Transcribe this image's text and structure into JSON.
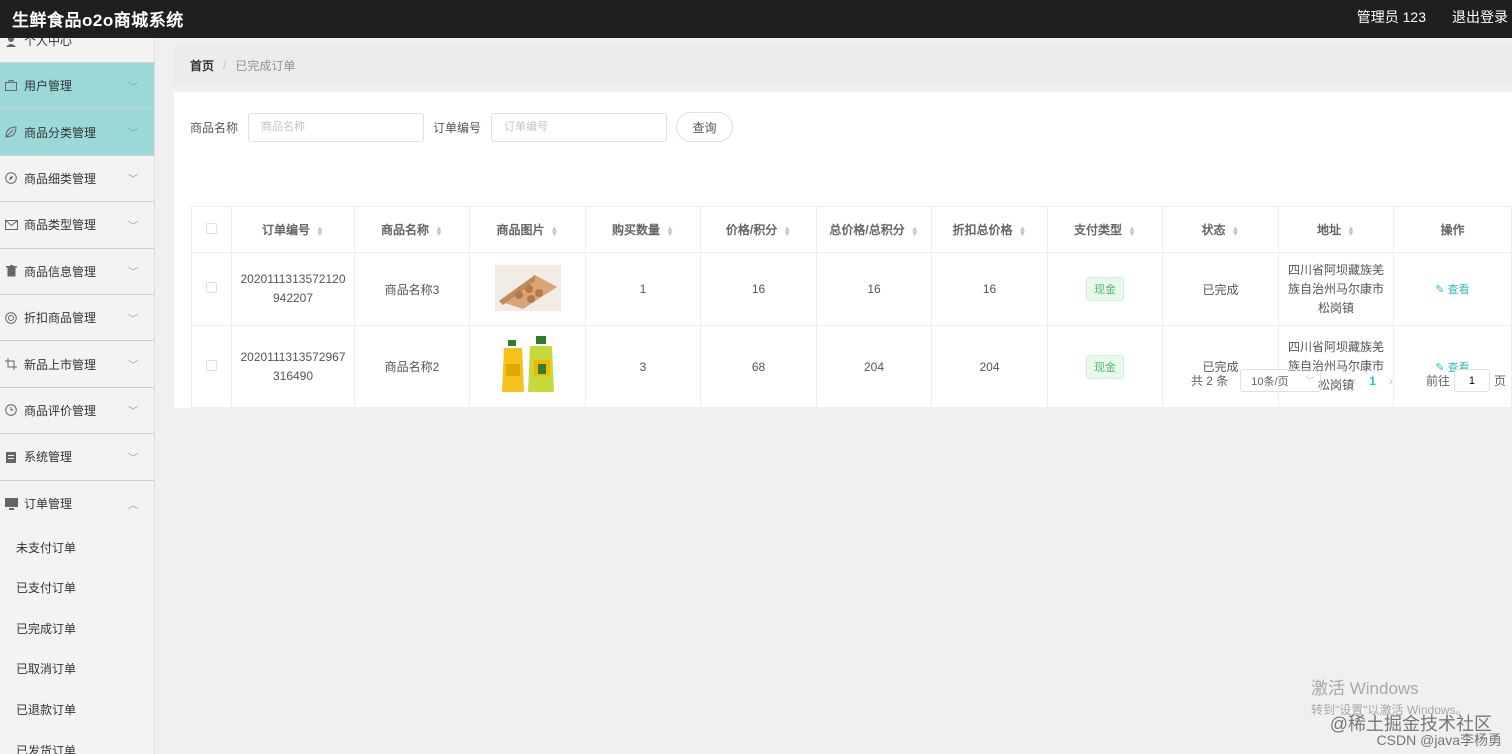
{
  "header": {
    "title": "生鲜食品o2o商城系统",
    "user": "管理员 123",
    "logout": "退出登录"
  },
  "sidebar": {
    "items": [
      {
        "label": "个人中心",
        "icon": "person-icon"
      },
      {
        "label": "用户管理",
        "icon": "briefcase-icon"
      },
      {
        "label": "商品分类管理",
        "icon": "leaf-icon"
      },
      {
        "label": "商品细类管理",
        "icon": "compass-icon"
      },
      {
        "label": "商品类型管理",
        "icon": "mail-icon"
      },
      {
        "label": "商品信息管理",
        "icon": "trash-icon"
      },
      {
        "label": "折扣商品管理",
        "icon": "target-icon"
      },
      {
        "label": "新品上市管理",
        "icon": "crop-icon"
      },
      {
        "label": "商品评价管理",
        "icon": "clock-icon"
      },
      {
        "label": "系统管理",
        "icon": "clipboard-icon"
      },
      {
        "label": "订单管理",
        "icon": "monitor-icon"
      }
    ],
    "sub_items": [
      {
        "label": "未支付订单"
      },
      {
        "label": "已支付订单"
      },
      {
        "label": "已完成订单"
      },
      {
        "label": "已取消订单"
      },
      {
        "label": "已退款订单"
      },
      {
        "label": "已发货订单"
      }
    ]
  },
  "breadcrumb": {
    "home": "首页",
    "separator": "/",
    "current": "已完成订单"
  },
  "filter": {
    "product_name_label": "商品名称",
    "product_name_placeholder": "商品名称",
    "order_no_label": "订单编号",
    "order_no_placeholder": "订单编号",
    "search_button": "查询"
  },
  "table": {
    "columns": [
      "订单编号",
      "商品名称",
      "商品图片",
      "购买数量",
      "价格/积分",
      "总价格/总积分",
      "折扣总价格",
      "支付类型",
      "状态",
      "地址",
      "操作"
    ],
    "rows": [
      {
        "order_no": "2020111313572120942207",
        "product_name": "商品名称3",
        "image": "egg-tray",
        "quantity": "1",
        "price": "16",
        "total": "16",
        "discount_total": "16",
        "pay_type": "现金",
        "status": "已完成",
        "address": "四川省阿坝藏族羌族自治州马尔康市松岗镇",
        "action": "查看"
      },
      {
        "order_no": "2020111313572967316490",
        "product_name": "商品名称2",
        "image": "cooking-oil",
        "quantity": "3",
        "price": "68",
        "total": "204",
        "discount_total": "204",
        "pay_type": "现金",
        "status": "已完成",
        "address": "四川省阿坝藏族羌族自治州马尔康市松岗镇",
        "action": "查看"
      }
    ]
  },
  "pagination": {
    "total": "共 2 条",
    "page_size": "10条/页",
    "prev": "‹",
    "current_page": "1",
    "next": "›",
    "goto_label": "前往",
    "goto_value": "1",
    "page_suffix": "页"
  },
  "overlay": {
    "activate_title": "激活 Windows",
    "activate_sub": "转到\"设置\"以激活 Windows。",
    "credit_1": "@稀土掘金技术社区",
    "credit_2": "CSDN @java李杨勇"
  },
  "colors": {
    "accent": "#2ebcc0",
    "sidebar_active": "#9ad9d8",
    "topbar": "#1f1f1f",
    "tag_green": "#52b86b"
  }
}
